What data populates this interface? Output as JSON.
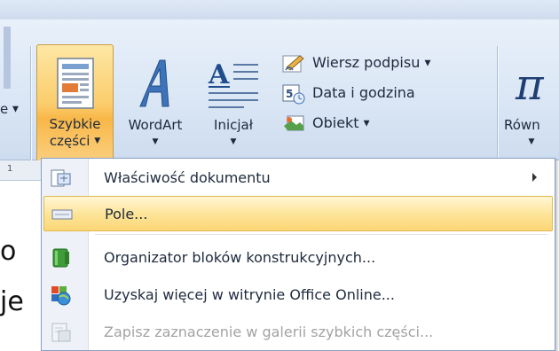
{
  "ribbon": {
    "left_fragment": "e",
    "quick_parts": {
      "line1": "Szybkie",
      "line2": "części"
    },
    "wordart": "WordArt",
    "drop_cap": "Inicjał",
    "small_buttons": [
      "Wiersz podpisu",
      "Data i godzina",
      "Obiekt"
    ],
    "right_fragment": "Równ"
  },
  "document": {
    "ruler_fragment": "1",
    "line1_fragment": "o",
    "line2_fragment": "je"
  },
  "menu": {
    "items": [
      {
        "label": "Właściwość dokumentu",
        "has_submenu": true,
        "state": "normal"
      },
      {
        "label": "Pole...",
        "has_submenu": false,
        "state": "highlighted"
      },
      {
        "label": "Organizator bloków konstrukcyjnych...",
        "has_submenu": false,
        "state": "normal"
      },
      {
        "label": "Uzyskaj więcej w witrynie Office Online...",
        "has_submenu": false,
        "state": "normal"
      },
      {
        "label": "Zapisz zaznaczenie w galerii szybkich części...",
        "has_submenu": false,
        "state": "disabled"
      }
    ]
  },
  "colors": {
    "highlight": "#fde59a",
    "ribbon": "#dbe7f5",
    "active_button": "#f8b748"
  },
  "icons": [
    "quick-parts-icon",
    "wordart-icon",
    "drop-cap-icon",
    "signature-line-icon",
    "date-time-icon",
    "object-icon",
    "equation-icon",
    "document-property-icon",
    "field-icon",
    "building-blocks-icon",
    "office-online-icon",
    "save-selection-icon"
  ]
}
